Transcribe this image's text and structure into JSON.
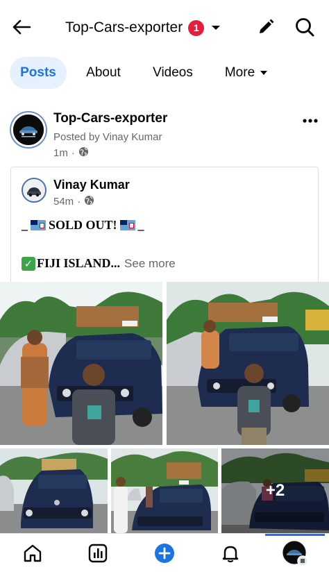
{
  "header": {
    "page_name": "Top-Cars-exporter",
    "notification_count": "1"
  },
  "tabs": [
    {
      "label": "Posts",
      "active": true
    },
    {
      "label": "About",
      "active": false
    },
    {
      "label": "Videos",
      "active": false
    },
    {
      "label": "More",
      "active": false
    }
  ],
  "post": {
    "author": "Top-Cars-exporter",
    "posted_by": "Posted by Vinay Kumar",
    "time": "1m",
    "dot": "·",
    "shared": {
      "author": "Vinay Kumar",
      "time": "54m",
      "dot": "·",
      "line1_prefix": "_",
      "line1_text": "SOLD OUT!",
      "line1_suffix": "_",
      "line2_text": "FIJI ISLAND...",
      "see_more": "See more"
    },
    "photos_extra": "+2"
  },
  "colors": {
    "accent": "#1b74e4",
    "badge": "#e41e3f",
    "secondary_text": "#65676b",
    "car_navy": "#1d2c4f"
  },
  "icons": {
    "back": "arrow-left-icon",
    "caret": "caret-down-icon",
    "edit": "pencil-icon",
    "search": "search-icon",
    "globe": "globe-icon",
    "more": "more-horizontal-icon",
    "nav": [
      "home-icon",
      "insights-icon",
      "create-icon",
      "notifications-icon",
      "profile-menu-icon"
    ]
  }
}
